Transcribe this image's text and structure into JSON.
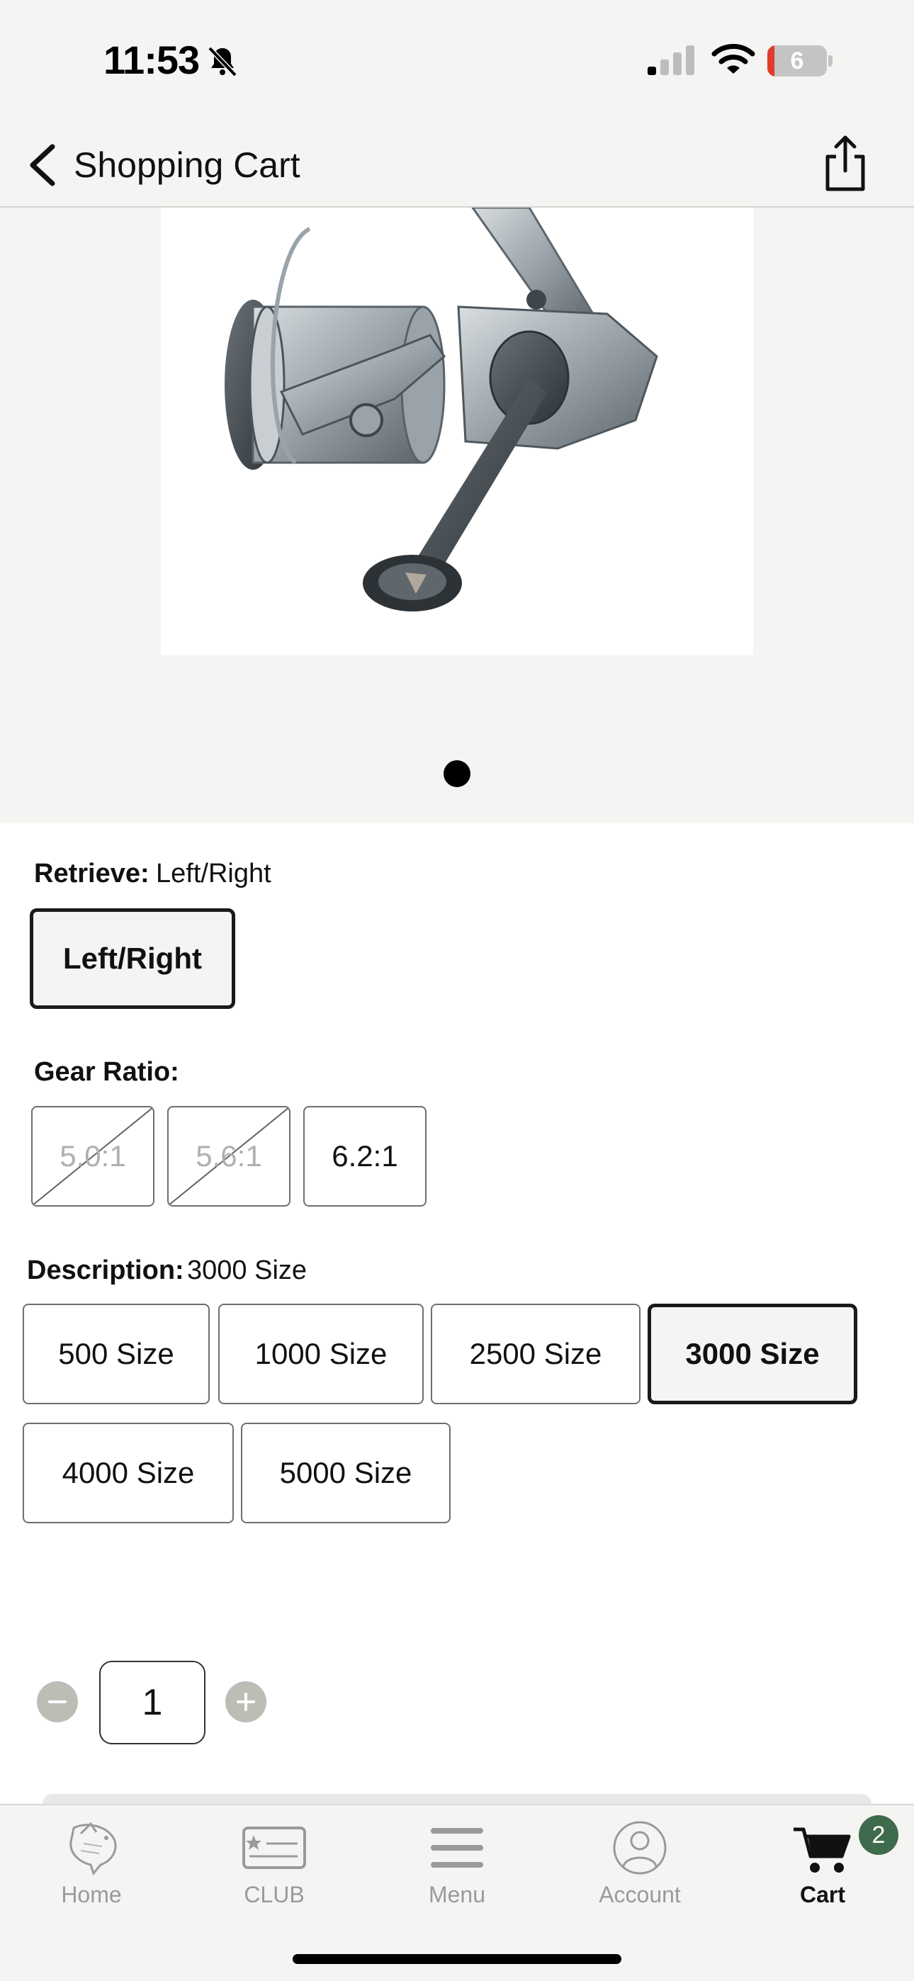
{
  "status_bar": {
    "time": "11:53",
    "battery_level": "6",
    "icons": [
      "bell-slash-icon",
      "signal-icon",
      "wifi-icon",
      "battery-icon"
    ]
  },
  "header": {
    "title": "Shopping Cart",
    "back_icon": "chevron-left-icon",
    "share_icon": "share-icon"
  },
  "gallery": {
    "image": "spinning-reel-product-image",
    "page_count": 1,
    "current_page": 1
  },
  "options": {
    "retrieve": {
      "label": "Retrieve:",
      "selected": "Left/Right",
      "choices": [
        "Left/Right"
      ]
    },
    "gear_ratio": {
      "label": "Gear Ratio:",
      "choices": [
        "5.0:1",
        "5.6:1",
        "6.2:1"
      ],
      "unavailable": [
        "5.0:1",
        "5.6:1"
      ]
    },
    "description": {
      "label": "Description:",
      "selected": "3000 Size",
      "choices": [
        "500 Size",
        "1000 Size",
        "2500 Size",
        "3000 Size",
        "4000 Size",
        "5000 Size"
      ]
    }
  },
  "quantity": {
    "value": "1"
  },
  "tab_bar": {
    "tabs": [
      {
        "label": "Home",
        "icon": "bass-fish-icon"
      },
      {
        "label": "CLUB",
        "icon": "club-card-icon"
      },
      {
        "label": "Menu",
        "icon": "hamburger-menu-icon"
      },
      {
        "label": "Account",
        "icon": "account-person-icon"
      },
      {
        "label": "Cart",
        "icon": "cart-icon",
        "badge": "2",
        "active": true
      }
    ]
  },
  "colors": {
    "background": "#f4f4f2",
    "accent_badge": "#3e6b4b",
    "selected_border": "#1a1a1a",
    "disabled_text": "#b0b0b0"
  }
}
